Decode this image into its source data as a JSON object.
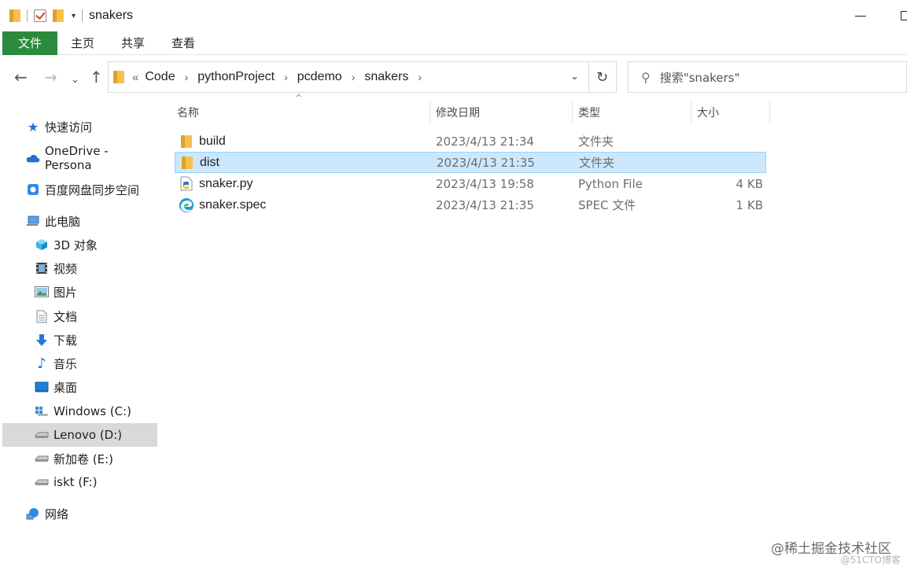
{
  "window": {
    "title": "snakers"
  },
  "ribbon": {
    "tabs": [
      "文件",
      "主页",
      "共享",
      "查看"
    ]
  },
  "address": {
    "crumbs": [
      "Code",
      "pythonProject",
      "pcdemo",
      "snakers"
    ],
    "overflow": "«",
    "separator": "›"
  },
  "search": {
    "placeholder": "搜索\"snakers\""
  },
  "sidebar": {
    "items": [
      {
        "label": "快速访问",
        "icon": "star-icon"
      },
      {
        "label": "OneDrive - Persona",
        "icon": "cloud-icon"
      },
      {
        "label": "百度网盘同步空间",
        "icon": "baidu-netdisk-icon"
      },
      {
        "label": "此电脑",
        "icon": "computer-icon"
      },
      {
        "label": "3D 对象",
        "icon": "cube-3d-icon"
      },
      {
        "label": "视频",
        "icon": "video-icon"
      },
      {
        "label": "图片",
        "icon": "picture-icon"
      },
      {
        "label": "文档",
        "icon": "document-icon"
      },
      {
        "label": "下载",
        "icon": "download-icon"
      },
      {
        "label": "音乐",
        "icon": "music-icon"
      },
      {
        "label": "桌面",
        "icon": "desktop-icon"
      },
      {
        "label": "Windows (C:)",
        "icon": "windows-drive-icon"
      },
      {
        "label": "Lenovo (D:)",
        "icon": "drive-icon"
      },
      {
        "label": "新加卷 (E:)",
        "icon": "drive-icon"
      },
      {
        "label": "iskt (F:)",
        "icon": "drive-icon"
      },
      {
        "label": "网络",
        "icon": "network-icon"
      }
    ],
    "selected": "Lenovo (D:)"
  },
  "filelist": {
    "columns": [
      "名称",
      "修改日期",
      "类型",
      "大小"
    ],
    "rows": [
      {
        "name": "build",
        "date": "2023/4/13 21:34",
        "type": "文件夹",
        "size": "",
        "icon": "folder-icon"
      },
      {
        "name": "dist",
        "date": "2023/4/13 21:35",
        "type": "文件夹",
        "size": "",
        "icon": "folder-icon"
      },
      {
        "name": "snaker.py",
        "date": "2023/4/13 19:58",
        "type": "Python File",
        "size": "4 KB",
        "icon": "python-file-icon"
      },
      {
        "name": "snaker.spec",
        "date": "2023/4/13 21:35",
        "type": "SPEC 文件",
        "size": "1 KB",
        "icon": "edge-file-icon"
      }
    ],
    "selected_row": "dist"
  },
  "colors": {
    "file_tab": "#2b8a3e",
    "selection": "#cce8ff",
    "selection_border": "#99d1ff",
    "sidebar_selected": "#d9d9d9",
    "folder": "#f5c24b"
  },
  "watermark": {
    "main": "@稀土掘金技术社区",
    "sub": "@51CTO博客"
  }
}
